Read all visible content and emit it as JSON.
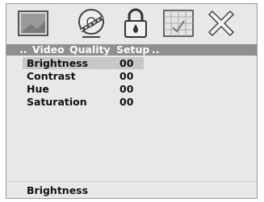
{
  "icons": [
    {
      "name": "picture-icon"
    },
    {
      "name": "disc-icon"
    },
    {
      "name": "lock-icon"
    },
    {
      "name": "grid-icon"
    },
    {
      "name": "close-icon"
    }
  ],
  "menu": {
    "lead": "..",
    "items": [
      "Video",
      "Quality",
      "Setup"
    ],
    "trail": ".."
  },
  "settings": [
    {
      "label": "Brightness",
      "value": "00"
    },
    {
      "label": "Contrast",
      "value": "00"
    },
    {
      "label": "Hue",
      "value": "00"
    },
    {
      "label": "Saturation",
      "value": "00"
    }
  ],
  "selected_index": 0,
  "status": {
    "text": "Brightness"
  },
  "colors": {
    "background": "#e8e8e8",
    "menu_bar": "#8f8f8f",
    "selected_row": "#c7c7c7",
    "text": "#111111"
  }
}
